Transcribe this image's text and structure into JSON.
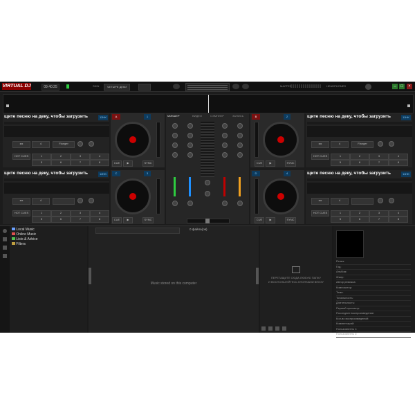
{
  "app": {
    "logo": "VIRTUAL DJ",
    "clock": "09:40:25",
    "browser_label": "ЧЕТЫРЕ ДЕКИ",
    "master_label": "МАСТЕР"
  },
  "decks": [
    {
      "id": "A",
      "title": "щите песню на деку, чтобы загрузить",
      "key": "12HK",
      "cue_label": "CUE",
      "fx": "Flanger",
      "hotcues": "HOT CUES",
      "pads": [
        "1",
        "2",
        "3",
        "4",
        "5",
        "6",
        "7",
        "8"
      ]
    },
    {
      "id": "B",
      "title": "щите песню на деку, чтобы загрузить",
      "key": "11HK",
      "cue_label": "CUE",
      "fx": "Flanger",
      "hotcues": "HOT CUES",
      "pads": [
        "1",
        "2",
        "3",
        "4",
        "5",
        "6",
        "7",
        "8"
      ]
    },
    {
      "id": "C",
      "title": "щите песню на деку, чтобы загрузить",
      "key": "12HK",
      "cue_label": "CUE",
      "fx": "",
      "hotcues": "HOT CUES",
      "pads": [
        "1",
        "2",
        "3",
        "4",
        "5",
        "6",
        "7",
        "8"
      ]
    },
    {
      "id": "D",
      "title": "щите песню на деку, чтобы загрузить",
      "key": "11HK",
      "cue_label": "CUE",
      "fx": "",
      "hotcues": "HOT CUES",
      "pads": [
        "1",
        "2",
        "3",
        "4",
        "5",
        "6",
        "7",
        "8"
      ]
    }
  ],
  "transport": {
    "cue": "CUE",
    "sync": "SYNC",
    "play": "▶"
  },
  "mixer": {
    "tabs": [
      "МИКШЕР",
      "ВИДЕО",
      "СЭМПЛЕР",
      "ЗАПИСЬ"
    ],
    "labels": [
      "HIGH",
      "MID",
      "LOW",
      "FILTER"
    ],
    "crossfader_label": "MASTER"
  },
  "browser": {
    "sidebar_items": [
      {
        "label": "Local Music",
        "color": "#6aa0ff"
      },
      {
        "label": "Online Music",
        "color": "#e05050"
      },
      {
        "label": "Lists & Advice",
        "color": "#50c050"
      },
      {
        "label": "Filters",
        "color": "#c0a040"
      }
    ],
    "file_count": "0 файла(ов)",
    "empty_message": "Music stored on this computer",
    "drop_text_1": "ПЕРЕТАЩИТЕ СЮДА ЛЮБУЮ ПАПКУ",
    "drop_text_2": "И ВОСПОЛЬЗУЙТЕСЬ КНОПКАМИ ВНИЗУ",
    "metadata_fields": [
      "Релиз:",
      "Год:",
      "Альбом:",
      "Жанр:",
      "Автор ремикса:",
      "Композитор:",
      "Темп:",
      "Тональность:",
      "Длительность:",
      "Первый просмотр:",
      "Последнее воспроизведение:",
      "Кол-во воспроизведений:",
      "Комментарий:",
      "Пользователь 1:",
      "Пользователь 2:"
    ]
  },
  "colors": {
    "accent_red": "#c00000",
    "accent_blue": "#1e90ff",
    "accent_green": "#2ecc40",
    "accent_yellow": "#f0a020"
  }
}
